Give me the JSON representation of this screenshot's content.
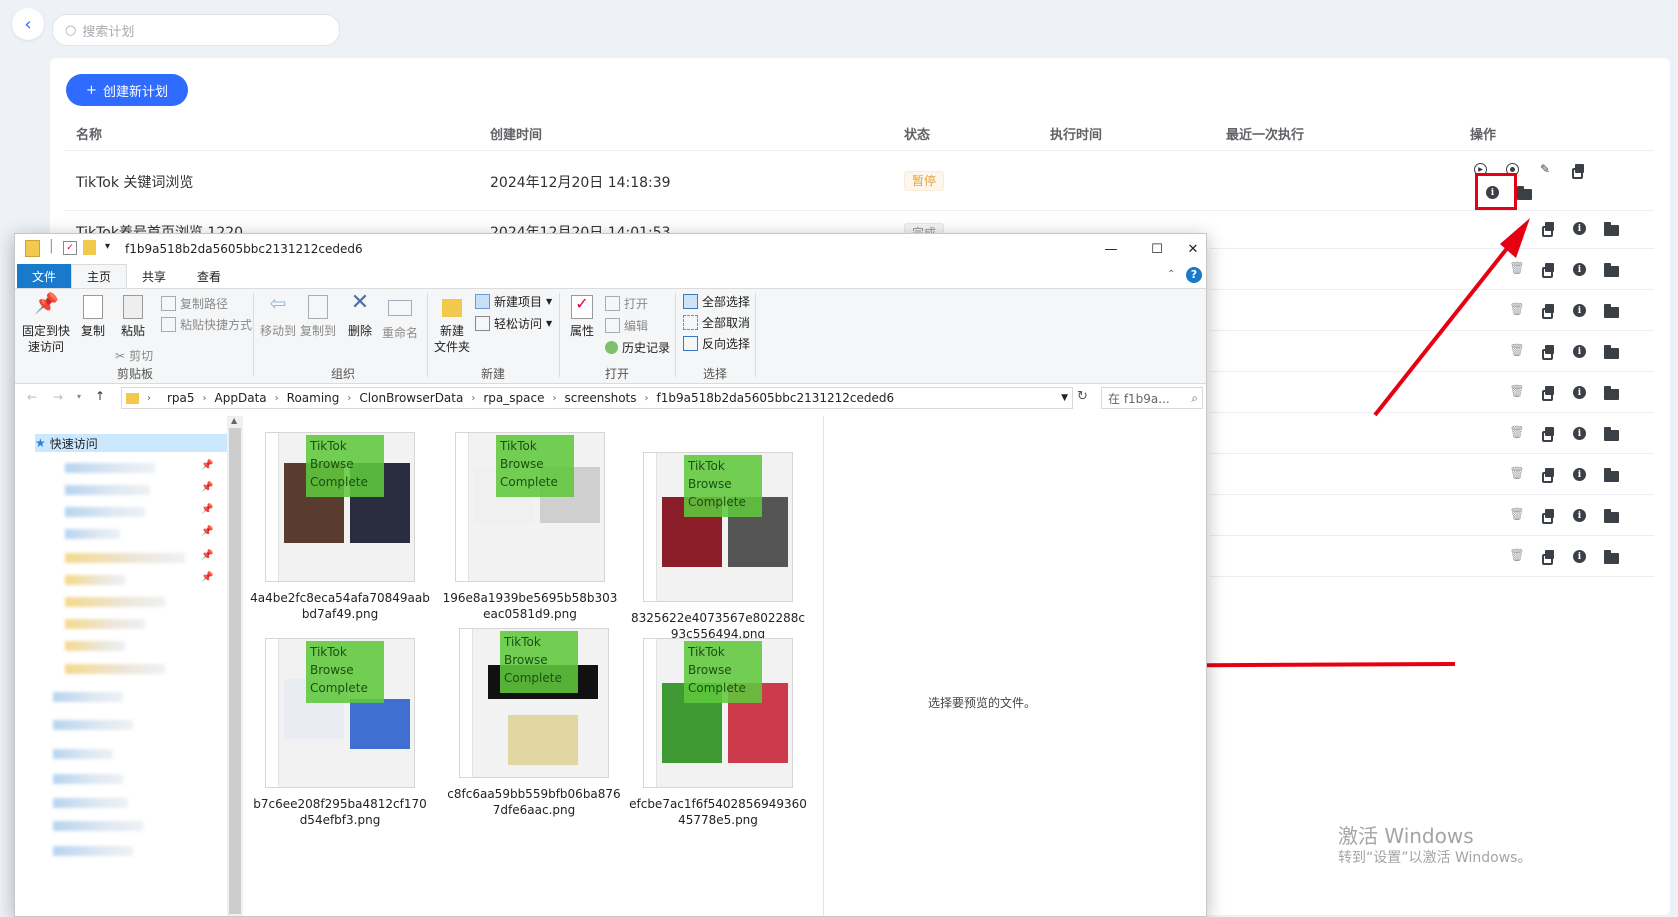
{
  "search": {
    "placeholder": "搜索计划"
  },
  "create_button": {
    "label": "创建新计划",
    "plus": "+"
  },
  "table": {
    "headers": [
      "名称",
      "创建时间",
      "状态",
      "执行时间",
      "最近一次执行",
      "操作"
    ],
    "rows": [
      {
        "name": "TikTok 关键词浏览",
        "created": "2024年12月20日 14:18:39",
        "status": "暂停"
      },
      {
        "name": "TikTok养号首页浏览 1220",
        "created": "2024年12月20日 14:01:53",
        "status": "完成"
      }
    ]
  },
  "explorer": {
    "title": "f1b9a518b2da5605bbc2131212ceded6",
    "tabs": {
      "file": "文件",
      "home": "主页",
      "share": "共享",
      "view": "查看"
    },
    "ribbon": {
      "pin": "固定到快\n速访问",
      "copy": "复制",
      "paste": "粘贴",
      "copy_path": "复制路径",
      "paste_shortcut": "粘贴快捷方式",
      "cut": "剪切",
      "clipboard": "剪贴板",
      "move_to": "移动到",
      "copy_to": "复制到",
      "delete": "删除",
      "rename": "重命名",
      "organize": "组织",
      "new_folder": "新建\n文件夹",
      "new_item": "新建项目",
      "easy_access": "轻松访问",
      "new": "新建",
      "properties": "属性",
      "open": "打开",
      "edit": "编辑",
      "history": "历史记录",
      "open_group": "打开",
      "select_all": "全部选择",
      "select_none": "全部取消",
      "invert": "反向选择",
      "select": "选择"
    },
    "path": [
      "rpa5",
      "AppData",
      "Roaming",
      "ClonBrowserData",
      "rpa_space",
      "screenshots",
      "f1b9a518b2da5605bbc2131212ceded6"
    ],
    "search_placeholder": "在 f1b9a...",
    "quick_access": "快速访问",
    "preview_text": "选择要预览的文件。",
    "overlay_text": [
      "TikTok",
      "Browse",
      "Complete"
    ],
    "files": [
      {
        "name": "4a4be2fc8eca54afa70849aabbd7af49.png"
      },
      {
        "name": "196e8a1939be5695b58b303eac0581d9.png"
      },
      {
        "name": "8325622e4073567e802288c93c556494.png"
      },
      {
        "name": "b7c6ee208f295ba4812cf170d54efbf3.png"
      },
      {
        "name": "c8fc6aa59bb559bfb06ba8767dfe6aac.png"
      },
      {
        "name": "efcbe7ac1f6f540285694936045778e5.png"
      }
    ]
  },
  "watermark": {
    "line1": "激活 Windows",
    "line2": "转到“设置”以激活 Windows。"
  },
  "colors": {
    "accent": "#2f6bff",
    "arrow": "#e60012",
    "highlight": "#e60012",
    "overlay_green": "#5fc83c"
  }
}
